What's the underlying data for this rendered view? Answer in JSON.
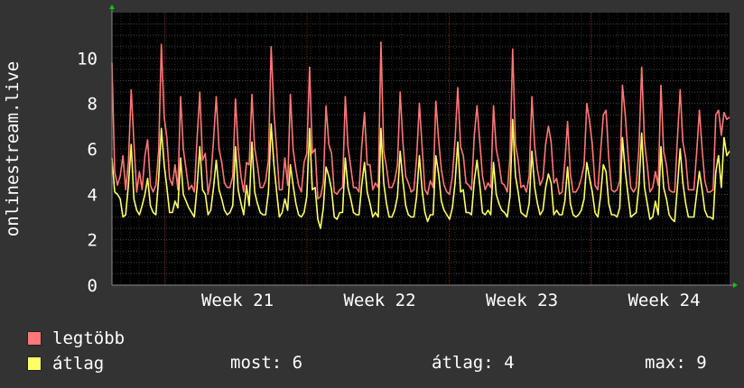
{
  "chart_data": {
    "type": "line",
    "ylabel": "onlinestream.live",
    "ylim": [
      0,
      12
    ],
    "yticks": [
      0,
      2,
      4,
      6,
      8,
      10
    ],
    "x_week_labels": [
      "Week 21",
      "Week 22",
      "Week 23",
      "Week 24"
    ],
    "grid": true,
    "series": [
      {
        "name": "legtöbb",
        "color": "#ff7777",
        "values": [
          9.8,
          5.0,
          4.4,
          4.8,
          5.7,
          4.2,
          5.4,
          8.6,
          6.3,
          4.1,
          5.0,
          4.2,
          5.7,
          6.4,
          4.4,
          4.1,
          4.4,
          5.9,
          10.6,
          7.4,
          6.5,
          4.7,
          4.4,
          5.3,
          4.2,
          8.3,
          6.0,
          5.1,
          4.2,
          4.4,
          4.1,
          6.4,
          8.5,
          5.5,
          5.8,
          4.0,
          4.7,
          6.4,
          8.3,
          6.0,
          5.4,
          4.5,
          4.3,
          4.3,
          4.8,
          8.2,
          6.0,
          4.8,
          4.1,
          5.4,
          5.3,
          8.4,
          6.0,
          5.3,
          4.3,
          4.3,
          4.6,
          5.5,
          10.5,
          7.6,
          6.0,
          4.2,
          4.2,
          5.6,
          4.4,
          8.4,
          6.0,
          5.1,
          4.4,
          4.1,
          5.4,
          5.8,
          9.6,
          5.8,
          6.0,
          3.8,
          3.9,
          4.5,
          7.9,
          6.2,
          5.8,
          4.1,
          4.0,
          4.2,
          4.3,
          8.3,
          6.1,
          5.2,
          4.3,
          4.3,
          4.1,
          6.1,
          7.6,
          5.3,
          5.3,
          4.2,
          4.5,
          4.3,
          10.7,
          5.9,
          5.2,
          4.3,
          4.3,
          4.6,
          5.3,
          8.5,
          6.3,
          4.8,
          4.5,
          4.1,
          4.2,
          5.6,
          8.0,
          6.1,
          4.2,
          4.0,
          4.6,
          4.3,
          8.1,
          6.4,
          5.1,
          4.4,
          4.1,
          4.0,
          4.8,
          6.4,
          8.7,
          6.1,
          5.7,
          4.5,
          4.4,
          4.2,
          6.6,
          7.9,
          6.3,
          4.8,
          4.2,
          4.5,
          4.3,
          7.9,
          6.0,
          5.4,
          4.5,
          4.4,
          4.1,
          5.6,
          10.4,
          6.2,
          5.5,
          4.3,
          4.4,
          4.1,
          4.8,
          8.3,
          6.1,
          5.1,
          4.4,
          4.7,
          6.2,
          7.0,
          6.3,
          4.5,
          4.7,
          4.0,
          4.1,
          5.4,
          7.2,
          4.9,
          4.1,
          4.1,
          4.3,
          4.7,
          5.3,
          8.0,
          7.2,
          6.2,
          4.4,
          4.2,
          5.8,
          7.5,
          7.7,
          5.6,
          4.2,
          4.1,
          4.2,
          4.6,
          8.8,
          7.5,
          5.8,
          4.3,
          4.1,
          4.3,
          6.1,
          9.6,
          6.3,
          5.3,
          4.1,
          4.3,
          5.0,
          4.4,
          8.8,
          5.9,
          5.3,
          4.2,
          4.1,
          4.1,
          6.4,
          8.6,
          6.3,
          5.6,
          4.2,
          4.2,
          4.2,
          5.8,
          7.7,
          6.0,
          4.6,
          4.1,
          4.1,
          4.2,
          7.5,
          7.7,
          6.6,
          7.6,
          7.3,
          7.4
        ]
      },
      {
        "name": "átlag",
        "color": "#ffff66",
        "values": [
          5.6,
          4.1,
          4.0,
          3.8,
          3.0,
          3.1,
          4.4,
          6.2,
          3.8,
          3.3,
          3.1,
          3.5,
          4.0,
          4.7,
          3.5,
          3.2,
          3.1,
          4.7,
          6.9,
          5.3,
          4.3,
          3.2,
          3.2,
          3.7,
          3.4,
          5.6,
          4.0,
          3.7,
          3.4,
          3.2,
          3.0,
          4.3,
          6.1,
          4.2,
          4.0,
          3.1,
          3.3,
          4.3,
          5.5,
          4.2,
          3.8,
          3.3,
          3.1,
          3.2,
          3.5,
          6.1,
          4.2,
          3.6,
          3.1,
          4.4,
          3.5,
          6.3,
          4.1,
          3.6,
          3.2,
          3.1,
          3.1,
          4.1,
          7.1,
          5.3,
          4.1,
          3.0,
          3.2,
          3.8,
          3.3,
          5.3,
          4.4,
          3.6,
          3.1,
          3.0,
          3.2,
          3.9,
          6.9,
          4.2,
          4.3,
          2.9,
          2.5,
          3.4,
          5.2,
          4.8,
          4.2,
          3.0,
          2.9,
          3.2,
          3.2,
          5.6,
          4.3,
          3.8,
          3.2,
          3.1,
          3.1,
          4.4,
          5.4,
          4.1,
          3.6,
          3.0,
          3.2,
          3.0,
          6.9,
          4.5,
          3.6,
          3.0,
          3.0,
          3.3,
          3.9,
          5.9,
          4.6,
          3.5,
          3.1,
          3.0,
          3.0,
          3.9,
          5.7,
          4.2,
          3.2,
          2.8,
          3.1,
          3.1,
          5.7,
          4.9,
          3.7,
          3.3,
          3.1,
          2.9,
          3.4,
          4.5,
          6.3,
          4.1,
          4.2,
          3.2,
          3.2,
          3.1,
          4.6,
          5.5,
          4.4,
          3.2,
          3.1,
          3.3,
          3.1,
          5.4,
          4.0,
          3.6,
          3.3,
          3.2,
          3.0,
          3.9,
          7.3,
          4.8,
          4.1,
          3.2,
          3.1,
          3.0,
          3.6,
          5.9,
          4.3,
          3.6,
          3.1,
          3.3,
          4.3,
          4.9,
          4.5,
          3.1,
          3.3,
          3.1,
          3.1,
          3.7,
          5.2,
          3.6,
          3.1,
          3.0,
          3.1,
          3.3,
          3.8,
          5.4,
          4.7,
          4.1,
          3.2,
          3.0,
          3.9,
          5.3,
          5.0,
          3.6,
          3.1,
          3.1,
          3.0,
          3.4,
          6.5,
          5.0,
          4.0,
          3.0,
          3.1,
          3.2,
          4.4,
          6.7,
          4.3,
          3.6,
          2.9,
          3.0,
          3.7,
          3.1,
          6.1,
          4.3,
          3.8,
          3.1,
          2.9,
          2.8,
          4.3,
          6.0,
          4.5,
          3.6,
          3.0,
          3.0,
          3.0,
          4.0,
          5.0,
          4.2,
          3.3,
          3.0,
          3.0,
          2.9,
          5.0,
          5.7,
          4.3,
          6.5,
          5.7,
          5.9
        ]
      }
    ]
  },
  "legend": [
    {
      "name": "legtöbb",
      "color": "#ff7777"
    },
    {
      "name": "átlag",
      "color": "#ffff66"
    }
  ],
  "stats": {
    "current_label": "most:",
    "current_value": "6",
    "average_label": "átlag:",
    "average_value": "4",
    "max_label": "max:",
    "max_value": "9"
  },
  "colors": {
    "background": "#333333",
    "plot_background": "#000000",
    "grid": "#4a4a4a",
    "week_line": "#6e2a2a",
    "axis_arrow": "#00cc00"
  }
}
